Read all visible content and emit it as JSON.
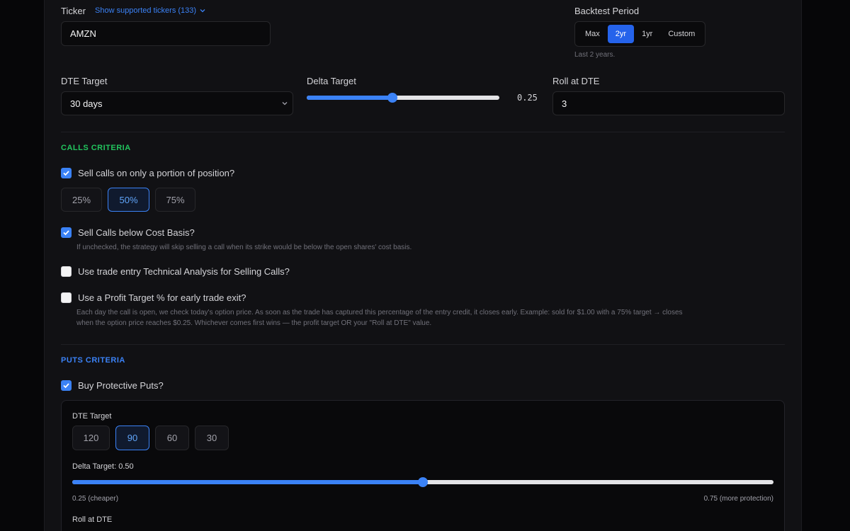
{
  "ticker": {
    "label": "Ticker",
    "supported_link": "Show supported tickers (133)",
    "value": "AMZN"
  },
  "backtest": {
    "label": "Backtest Period",
    "options": [
      "Max",
      "2yr",
      "1yr",
      "Custom"
    ],
    "selected": "2yr",
    "hint": "Last 2 years."
  },
  "dte": {
    "label": "DTE Target",
    "value": "30 days"
  },
  "delta": {
    "label": "Delta Target",
    "value_text": "0.25",
    "value": 0.25
  },
  "roll": {
    "label": "Roll at DTE",
    "value": "3"
  },
  "calls": {
    "title": "CALLS CRITERIA",
    "portion": {
      "label": "Sell calls on only a portion of position?",
      "checked": true
    },
    "portion_options": [
      "25%",
      "50%",
      "75%"
    ],
    "portion_selected": "50%",
    "below_cost": {
      "label": "Sell Calls below Cost Basis?",
      "checked": true,
      "desc": "If unchecked, the strategy will skip selling a call when its strike would be below the open shares' cost basis."
    },
    "technical": {
      "label": "Use trade entry Technical Analysis for Selling Calls?",
      "checked": false
    },
    "profit_target": {
      "label": "Use a Profit Target % for early trade exit?",
      "checked": false,
      "desc_line1": "Each day the call is open, we check today's option price. As soon as the trade has captured this percentage of the entry credit, it closes early. Example: sold for $1.00 with a 75% target → closes",
      "desc_line2": "when the option price reaches $0.25. Whichever comes first wins — the profit target OR your \"Roll at DTE\" value."
    }
  },
  "puts": {
    "title": "PUTS CRITERIA",
    "protective": {
      "label": "Buy Protective Puts?",
      "checked": true
    },
    "dte_label": "DTE Target",
    "dte_options": [
      "120",
      "90",
      "60",
      "30"
    ],
    "dte_selected": "90",
    "delta_label": "Delta Target: 0.50",
    "delta_value": 0.5,
    "delta_min_label": "0.25 (cheaper)",
    "delta_max_label": "0.75 (more protection)",
    "roll_label": "Roll at DTE"
  },
  "colors": {
    "accent": "#3b82f6",
    "calls_title": "#22c55e",
    "puts_title": "#3b82f6",
    "background": "#111114"
  }
}
